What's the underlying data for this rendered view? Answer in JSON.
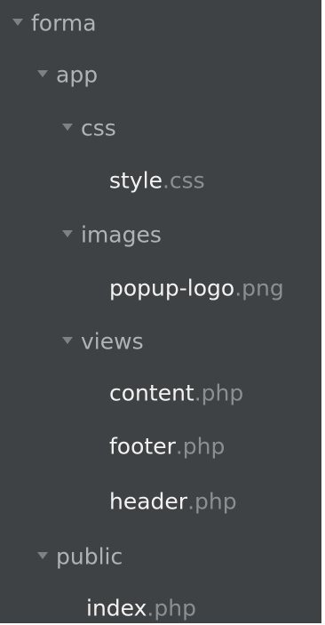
{
  "tree": {
    "nodes": [
      {
        "kind": "folder",
        "label": "forma",
        "expanded": true
      },
      {
        "kind": "folder",
        "label": "app",
        "expanded": true
      },
      {
        "kind": "folder",
        "label": "css",
        "expanded": true
      },
      {
        "kind": "file",
        "name": "style",
        "ext": ".css"
      },
      {
        "kind": "folder",
        "label": "images",
        "expanded": true
      },
      {
        "kind": "file",
        "name": "popup-logo",
        "ext": ".png"
      },
      {
        "kind": "folder",
        "label": "views",
        "expanded": true
      },
      {
        "kind": "file",
        "name": "content",
        "ext": ".php"
      },
      {
        "kind": "file",
        "name": "footer",
        "ext": ".php"
      },
      {
        "kind": "file",
        "name": "header",
        "ext": ".php"
      },
      {
        "kind": "folder",
        "label": "public",
        "expanded": true
      },
      {
        "kind": "file",
        "name": "index",
        "ext": ".php"
      }
    ]
  },
  "colors": {
    "background": "#3f4244",
    "folder_text": "#b0b3b6",
    "file_name": "#f2f2f2",
    "file_extension": "#8b8f92",
    "disclosure_arrow": "#7d8184"
  },
  "icons": {
    "folder_expanded": "disclosure-triangle-down-icon"
  }
}
